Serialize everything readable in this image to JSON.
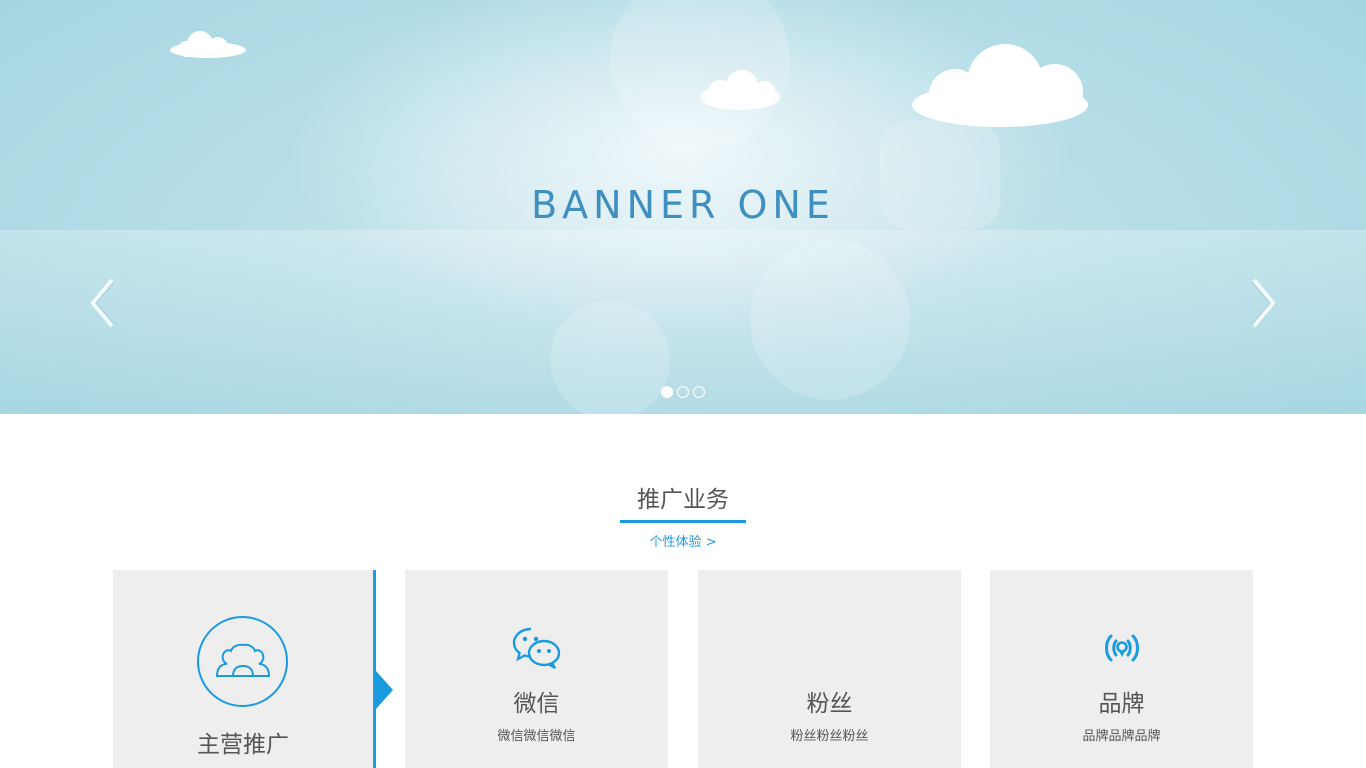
{
  "banner": {
    "title": "BANNER ONE",
    "slide_count": 3,
    "active_slide": 1,
    "prev_icon": "chevron-left-icon",
    "next_icon": "chevron-right-icon"
  },
  "section": {
    "title": "推广业务",
    "link": "个性体验 >"
  },
  "cards": [
    {
      "title": "主营推广",
      "icon": "users-group-icon"
    },
    {
      "title": "微信",
      "desc": "微信微信微信",
      "icon": "wechat-icon"
    },
    {
      "title": "粉丝",
      "desc": "粉丝粉丝粉丝",
      "icon": "fans-icon"
    },
    {
      "title": "品牌",
      "desc": "品牌品牌品牌",
      "icon": "broadcast-icon"
    }
  ],
  "colors": {
    "accent": "#1a9be0",
    "banner_text": "#3f8fc0",
    "card_bg": "#eeeeee",
    "text": "#555555"
  }
}
